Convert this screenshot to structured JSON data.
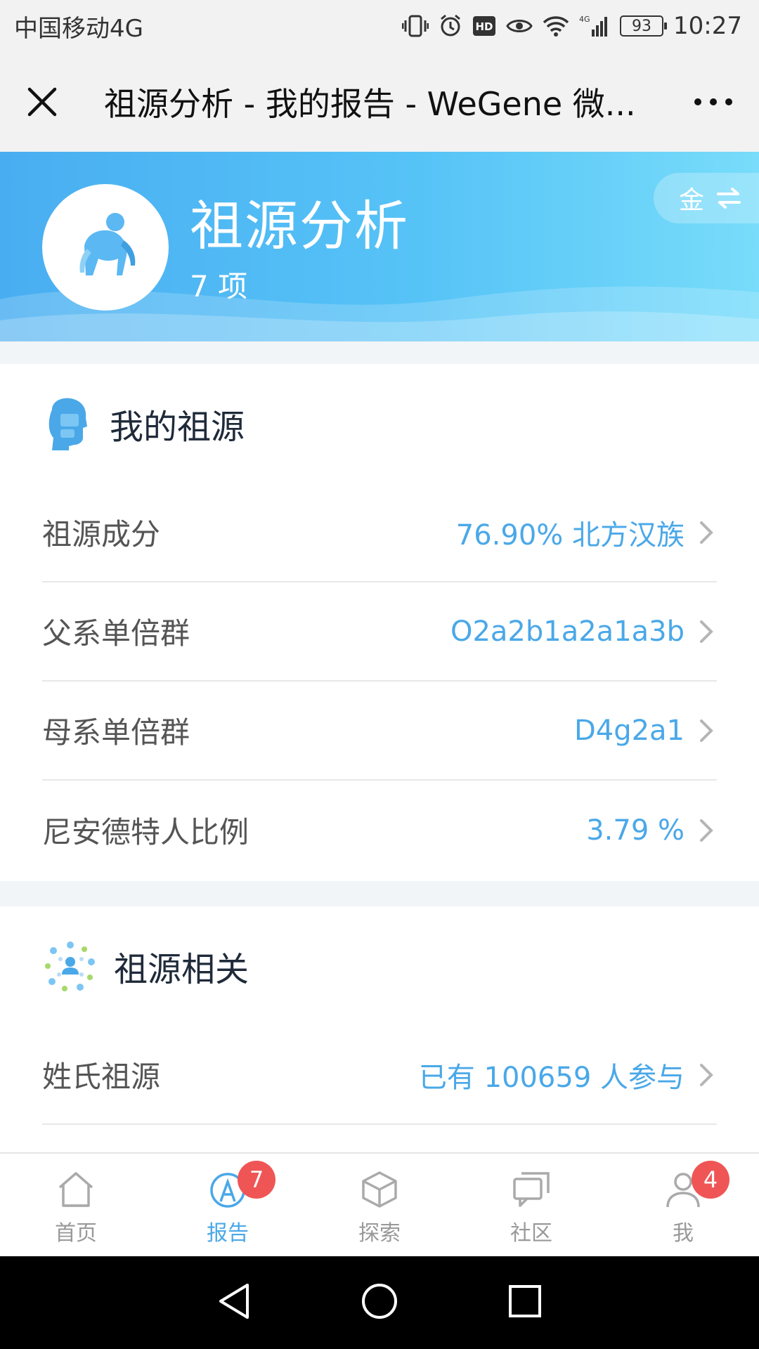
{
  "status_bar": {
    "carrier": "中国移动4G",
    "network": "4G",
    "battery": "93",
    "time": "10:27"
  },
  "nav": {
    "title": "祖源分析 - 我的报告 - WeGene 微..."
  },
  "banner": {
    "title": "祖源分析",
    "count": "7 项",
    "switch_label": "金"
  },
  "section_ancestry": {
    "title": "我的祖源",
    "rows": [
      {
        "label": "祖源成分",
        "value": "76.90% 北方汉族"
      },
      {
        "label": "父系单倍群",
        "value": "O2a2b1a2a1a3b"
      },
      {
        "label": "母系单倍群",
        "value": "D4g2a1"
      },
      {
        "label": "尼安德特人比例",
        "value": "3.79 %"
      }
    ]
  },
  "section_related": {
    "title": "祖源相关",
    "rows": [
      {
        "label": "姓氏祖源",
        "value": "已有 100659 人参与"
      }
    ]
  },
  "tabs": [
    {
      "label": "首页",
      "icon": "home-icon"
    },
    {
      "label": "报告",
      "icon": "report-icon",
      "badge": "7"
    },
    {
      "label": "探索",
      "icon": "cube-icon"
    },
    {
      "label": "社区",
      "icon": "chat-icon"
    },
    {
      "label": "我",
      "icon": "person-icon",
      "badge": "4"
    }
  ],
  "colors": {
    "accent": "#4aa8e8",
    "badge": "#f05555",
    "banner_start": "#49aef1",
    "banner_end": "#78dcfa"
  }
}
